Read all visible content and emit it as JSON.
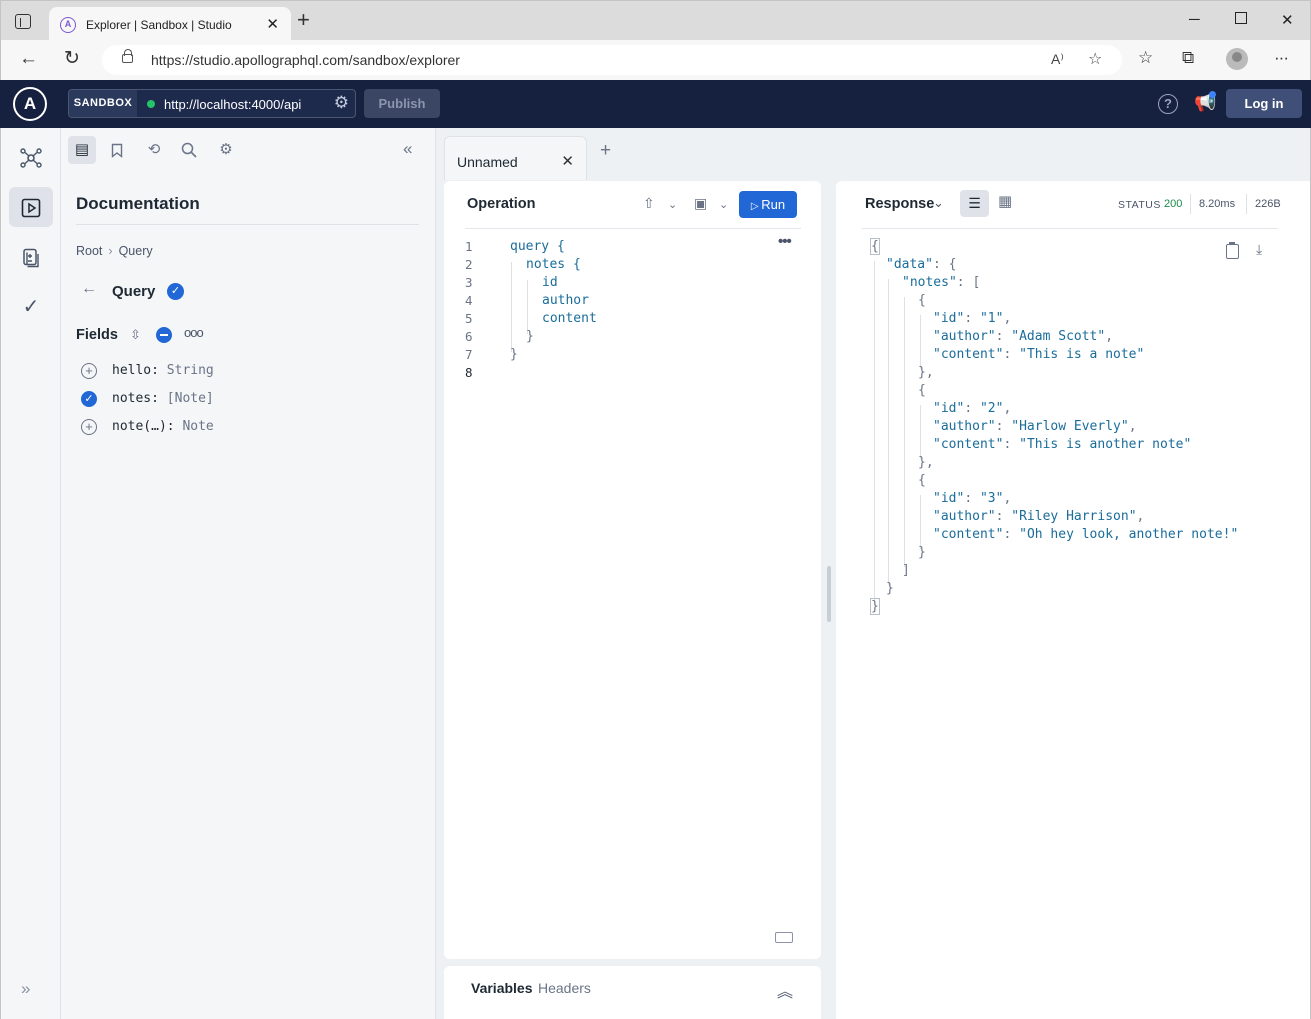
{
  "browser": {
    "tab_title": "Explorer | Sandbox | Studio",
    "favicon_letter": "A",
    "url": "https://studio.apollographql.com/sandbox/explorer"
  },
  "header": {
    "logo_letter": "A",
    "sandbox_label": "SANDBOX",
    "endpoint": "http://localhost:4000/api",
    "publish_label": "Publish",
    "help_label": "?",
    "login_label": "Log in"
  },
  "doc": {
    "title": "Documentation",
    "breadcrumb": [
      "Root",
      "Query"
    ],
    "type_title": "Query",
    "fields_label": "Fields",
    "fields": [
      {
        "name": "hello:",
        "type": "String",
        "selected": false
      },
      {
        "name": "notes:",
        "type": "[Note]",
        "selected": true
      },
      {
        "name": "note(…):",
        "type": "Note",
        "selected": false
      }
    ]
  },
  "operation": {
    "tab_label": "Unnamed",
    "title": "Operation",
    "run_label": "Run",
    "lines": [
      {
        "num": "1",
        "text": "query {"
      },
      {
        "num": "2",
        "text": "notes {"
      },
      {
        "num": "3",
        "text": "id"
      },
      {
        "num": "4",
        "text": "author"
      },
      {
        "num": "5",
        "text": "content"
      },
      {
        "num": "6",
        "text": "}"
      },
      {
        "num": "7",
        "text": "}"
      },
      {
        "num": "8",
        "text": ""
      }
    ]
  },
  "variables": {
    "variables_tab": "Variables",
    "headers_tab": "Headers"
  },
  "response": {
    "title": "Response",
    "status_label": "STATUS",
    "status_code": "200",
    "time": "8.20ms",
    "size": "226B",
    "notes": [
      {
        "id": "1",
        "author": "Adam Scott",
        "content": "This is a note"
      },
      {
        "id": "2",
        "author": "Harlow Everly",
        "content": "This is another note"
      },
      {
        "id": "3",
        "author": "Riley Harrison",
        "content": "Oh hey look, another note!"
      }
    ]
  },
  "colors": {
    "header_bg": "#16213f",
    "run_button": "#2167d6",
    "status_ok": "#1b8a4b"
  }
}
